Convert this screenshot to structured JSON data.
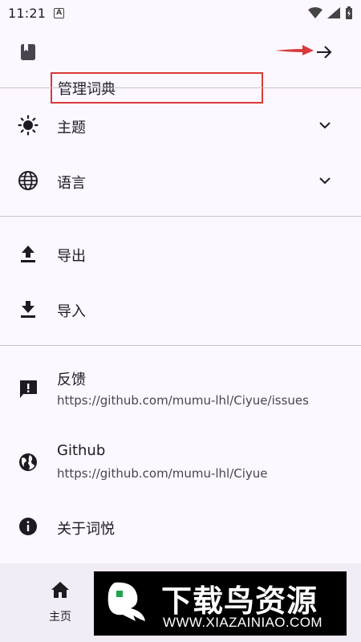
{
  "status_bar": {
    "time": "11:21",
    "notif_letter": "A"
  },
  "dictionary": {
    "label": "管理词典"
  },
  "settings": [
    {
      "label": "主题"
    },
    {
      "label": "语言"
    }
  ],
  "data_actions": [
    {
      "label": "导出"
    },
    {
      "label": "导入"
    }
  ],
  "about": {
    "feedback_label": "反馈",
    "feedback_url": "https://github.com/mumu-lhl/Ciyue/issues",
    "github_label": "Github",
    "github_url": "https://github.com/mumu-lhl/Ciyue",
    "about_label": "关于词悦"
  },
  "bottom_nav": {
    "home_label": "主页"
  },
  "watermark": {
    "title": "下载鸟资源",
    "url": "WWW.XIAZAINIAO.COM"
  },
  "colors": {
    "background": "#fdf7ff",
    "annotation_red": "#d93a3a",
    "nav_bg": "#f2ecf6"
  }
}
